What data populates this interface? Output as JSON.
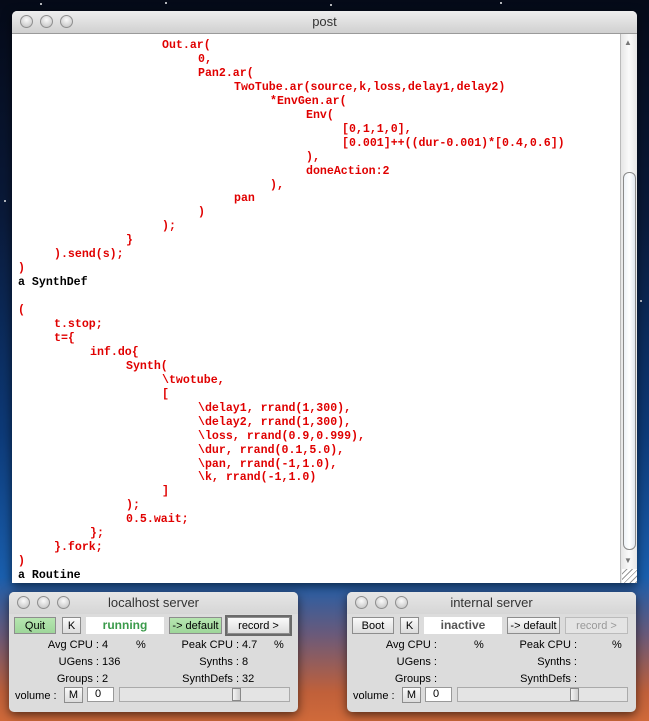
{
  "post_window": {
    "title": "post",
    "lines": [
      {
        "indent": 4,
        "text": "Out.ar("
      },
      {
        "indent": 5,
        "text": "0,"
      },
      {
        "indent": 5,
        "text": "Pan2.ar("
      },
      {
        "indent": 6,
        "text": "TwoTube.ar(source,k,loss,delay1,delay2)"
      },
      {
        "indent": 7,
        "text": "*EnvGen.ar("
      },
      {
        "indent": 8,
        "text": "Env("
      },
      {
        "indent": 9,
        "text": "[0,1,1,0],"
      },
      {
        "indent": 9,
        "text": "[0.001]++((dur-0.001)*[0.4,0.6])"
      },
      {
        "indent": 8,
        "text": "),"
      },
      {
        "indent": 8,
        "text": "doneAction:2"
      },
      {
        "indent": 7,
        "text": "),"
      },
      {
        "indent": 6,
        "text": "pan"
      },
      {
        "indent": 5,
        "text": ")"
      },
      {
        "indent": 4,
        "text": ");"
      },
      {
        "indent": 3,
        "text": "}"
      },
      {
        "indent": 1,
        "text": ").send(s);"
      },
      {
        "indent": 0,
        "text": ")"
      },
      {
        "indent": 0,
        "text": "a SynthDef",
        "color": "black"
      },
      {
        "indent": 0,
        "text": ""
      },
      {
        "indent": 0,
        "text": "("
      },
      {
        "indent": 1,
        "text": "t.stop;"
      },
      {
        "indent": 1,
        "text": "t={"
      },
      {
        "indent": 2,
        "text": "inf.do{"
      },
      {
        "indent": 3,
        "text": "Synth("
      },
      {
        "indent": 4,
        "text": "\\twotube,"
      },
      {
        "indent": 4,
        "text": "["
      },
      {
        "indent": 5,
        "text": "\\delay1, rrand(1,300),"
      },
      {
        "indent": 5,
        "text": "\\delay2, rrand(1,300),"
      },
      {
        "indent": 5,
        "text": "\\loss, rrand(0.9,0.999),"
      },
      {
        "indent": 5,
        "text": "\\dur, rrand(0.1,5.0),"
      },
      {
        "indent": 5,
        "text": "\\pan, rrand(-1,1.0),"
      },
      {
        "indent": 5,
        "text": "\\k, rrand(-1,1.0)"
      },
      {
        "indent": 4,
        "text": "]"
      },
      {
        "indent": 3,
        "text": ");"
      },
      {
        "indent": 3,
        "text": "0.5.wait;"
      },
      {
        "indent": 2,
        "text": "};"
      },
      {
        "indent": 1,
        "text": "}.fork;"
      },
      {
        "indent": 0,
        "text": ")"
      },
      {
        "indent": 0,
        "text": "a Routine",
        "color": "black"
      }
    ]
  },
  "localhost": {
    "title": "localhost server",
    "boot_label": "Quit",
    "kill_label": "K",
    "status": "running",
    "default_label": "-> default",
    "record_label": "record >",
    "avg_cpu_label": "Avg CPU :",
    "avg_cpu": "4",
    "pct1": "%",
    "peak_cpu_label": "Peak CPU :",
    "peak_cpu": "4.7",
    "pct2": "%",
    "ugens_label": "UGens :",
    "ugens": "136",
    "synths_label": "Synths :",
    "synths": "8",
    "groups_label": "Groups :",
    "groups": "2",
    "synthdefs_label": "SynthDefs :",
    "synthdefs": "32",
    "volume_label": "volume :",
    "mute_label": "M",
    "volume": "0",
    "volume_slider_fraction": 0.7
  },
  "internal": {
    "title": "internal server",
    "boot_label": "Boot",
    "kill_label": "K",
    "status": "inactive",
    "default_label": "-> default",
    "record_label": "record >",
    "avg_cpu_label": "Avg CPU :",
    "avg_cpu": "",
    "pct1": "%",
    "peak_cpu_label": "Peak CPU :",
    "peak_cpu": "",
    "pct2": "%",
    "ugens_label": "UGens :",
    "ugens": "",
    "synths_label": "Synths :",
    "synths": "",
    "groups_label": "Groups :",
    "groups": "",
    "synthdefs_label": "SynthDefs :",
    "synthdefs": "",
    "volume_label": "volume :",
    "mute_label": "M",
    "volume": "0",
    "volume_slider_fraction": 0.7
  },
  "colors": {
    "code": "#e00000",
    "output": "#000000",
    "running": "#3a9a4a",
    "inactive": "#555555"
  }
}
